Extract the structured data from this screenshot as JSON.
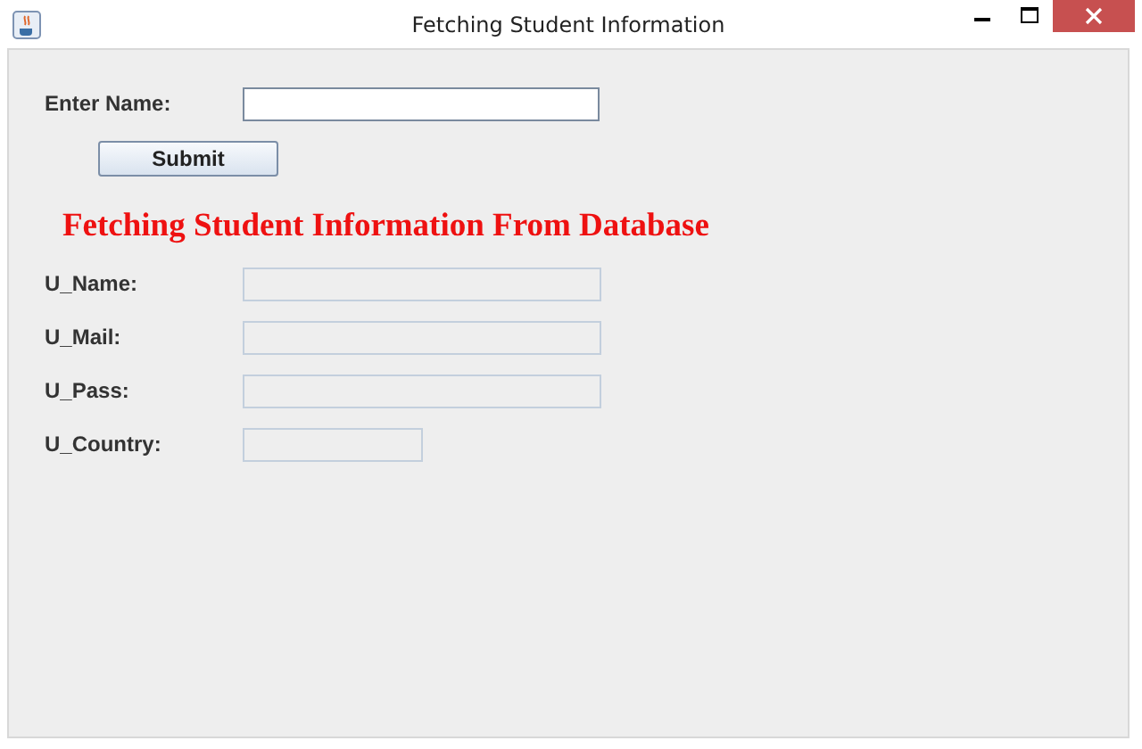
{
  "window": {
    "title": "Fetching Student Information"
  },
  "name_field": {
    "label": "Enter Name:",
    "disabled": false
  },
  "submit_button": "Submit",
  "heading": "Fetching Student Information From Database",
  "fields": [
    {
      "label": "U_Name:",
      "disabled": true,
      "kind": "long"
    },
    {
      "label": "U_Mail:",
      "disabled": true,
      "kind": "long"
    },
    {
      "label": "U_Pass:",
      "disabled": true,
      "kind": "long"
    },
    {
      "label": "U_Country:",
      "disabled": true,
      "kind": "short"
    }
  ]
}
